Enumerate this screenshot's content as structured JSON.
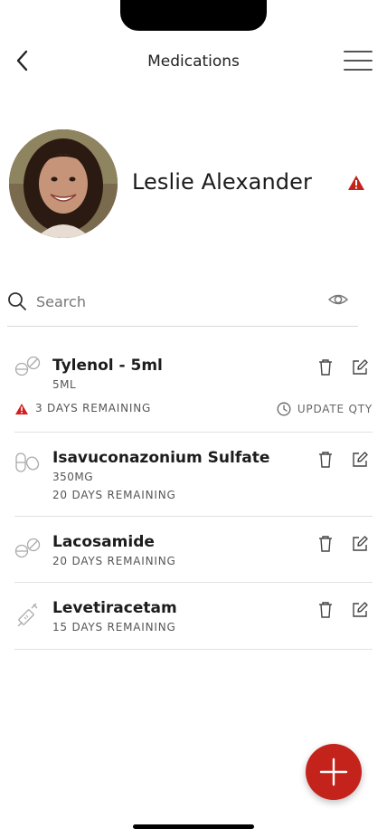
{
  "header": {
    "title": "Medications",
    "back_icon": "chevron-left-icon",
    "menu_icon": "hamburger-icon"
  },
  "profile": {
    "name": "Leslie Alexander",
    "alert_icon": "warning-triangle-icon"
  },
  "search": {
    "placeholder": "Search",
    "value": ""
  },
  "colors": {
    "accent": "#c4231c",
    "warning": "#d11f1f"
  },
  "medications": [
    {
      "name": "Tylenol - 5ml",
      "dose": "5ML",
      "remaining": "3 DAYS REMAINING",
      "warning": true,
      "update_qty": "UPDATE QTY",
      "icon": "tablet-icon"
    },
    {
      "name": "Isavuconazonium Sulfate",
      "dose": "350MG",
      "remaining": "20 DAYS REMAINING",
      "warning": false,
      "icon": "capsule-icon"
    },
    {
      "name": "Lacosamide",
      "dose": "",
      "remaining": "20 DAYS REMAINING",
      "warning": false,
      "icon": "tablet-icon"
    },
    {
      "name": "Levetiracetam",
      "dose": "",
      "remaining": "15 DAYS REMAINING",
      "warning": false,
      "icon": "syringe-icon"
    }
  ],
  "fab": {
    "icon": "plus-icon"
  }
}
